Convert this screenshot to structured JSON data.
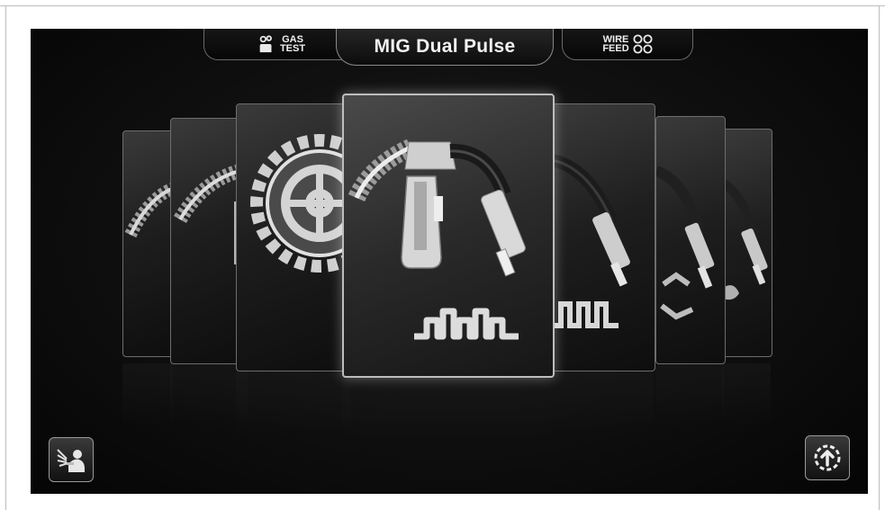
{
  "top_tabs": {
    "gas_test": {
      "line1": "GAS",
      "line2": "TEST",
      "icon": "gas-bottle-icon"
    },
    "mode_title": "MIG Dual Pulse",
    "wire_feed": {
      "line1": "WIRE",
      "line2": "FEED",
      "icon": "wire-spools-icon"
    }
  },
  "cards": [
    {
      "name": "card-mig-far-left",
      "icon": "torch-icon"
    },
    {
      "name": "card-mig-left",
      "icon": "torch-icon"
    },
    {
      "name": "card-settings",
      "icon": "gear-icon"
    },
    {
      "name": "card-mig-dual-pulse",
      "icon": "torch-dual-pulse-icon",
      "selected": true
    },
    {
      "name": "card-mig-pulse",
      "icon": "torch-pulse-icon"
    },
    {
      "name": "card-mig-recycle",
      "icon": "torch-recycle-icon"
    },
    {
      "name": "card-mig-far-right",
      "icon": "torch-icon"
    }
  ],
  "buttons": {
    "welder": {
      "icon": "welder-icon"
    },
    "upload": {
      "icon": "upload-circle-icon"
    }
  },
  "colors": {
    "background": "#000000",
    "accent": "#ffffff",
    "frame": "#bdbdbd"
  }
}
